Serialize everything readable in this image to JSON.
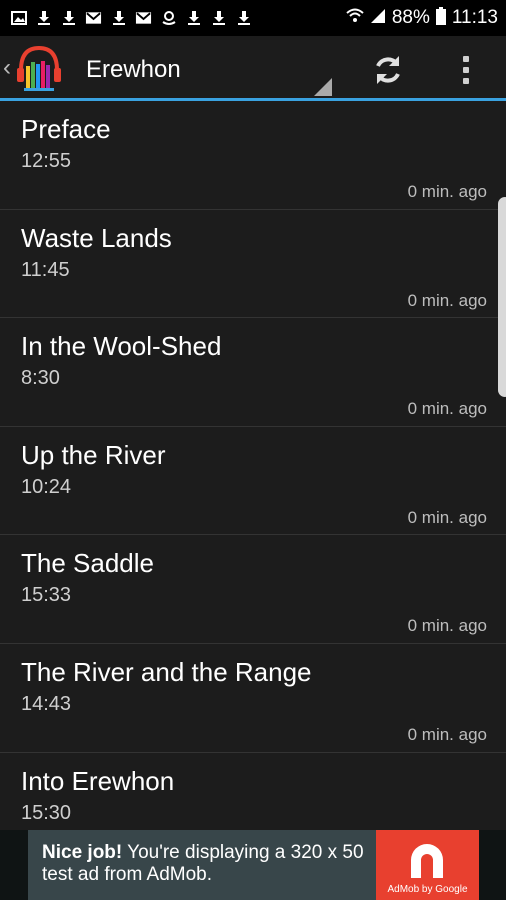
{
  "status_bar": {
    "battery": "88%",
    "time": "11:13",
    "icons": [
      "image-icon",
      "download-icon",
      "download-icon",
      "gmail-icon",
      "download-icon",
      "gmail-icon",
      "amazon-icon",
      "download-icon",
      "download-icon",
      "download-icon"
    ]
  },
  "action_bar": {
    "title": "Erewhon",
    "accent_color": "#3aa2e0"
  },
  "chapters": [
    {
      "title": "Preface",
      "duration": "12:55",
      "ago": "0 min. ago"
    },
    {
      "title": "Waste Lands",
      "duration": "11:45",
      "ago": "0 min. ago"
    },
    {
      "title": "In the Wool-Shed",
      "duration": "8:30",
      "ago": "0 min. ago"
    },
    {
      "title": "Up the River",
      "duration": "10:24",
      "ago": "0 min. ago"
    },
    {
      "title": "The Saddle",
      "duration": "15:33",
      "ago": "0 min. ago"
    },
    {
      "title": "The River and the Range",
      "duration": "14:43",
      "ago": "0 min. ago"
    },
    {
      "title": "Into Erewhon",
      "duration": "15:30",
      "ago": ""
    }
  ],
  "ad": {
    "bold": "Nice job!",
    "text": " You're displaying a 320 x 50 test ad from AdMob.",
    "brand": "AdMob by Google"
  }
}
